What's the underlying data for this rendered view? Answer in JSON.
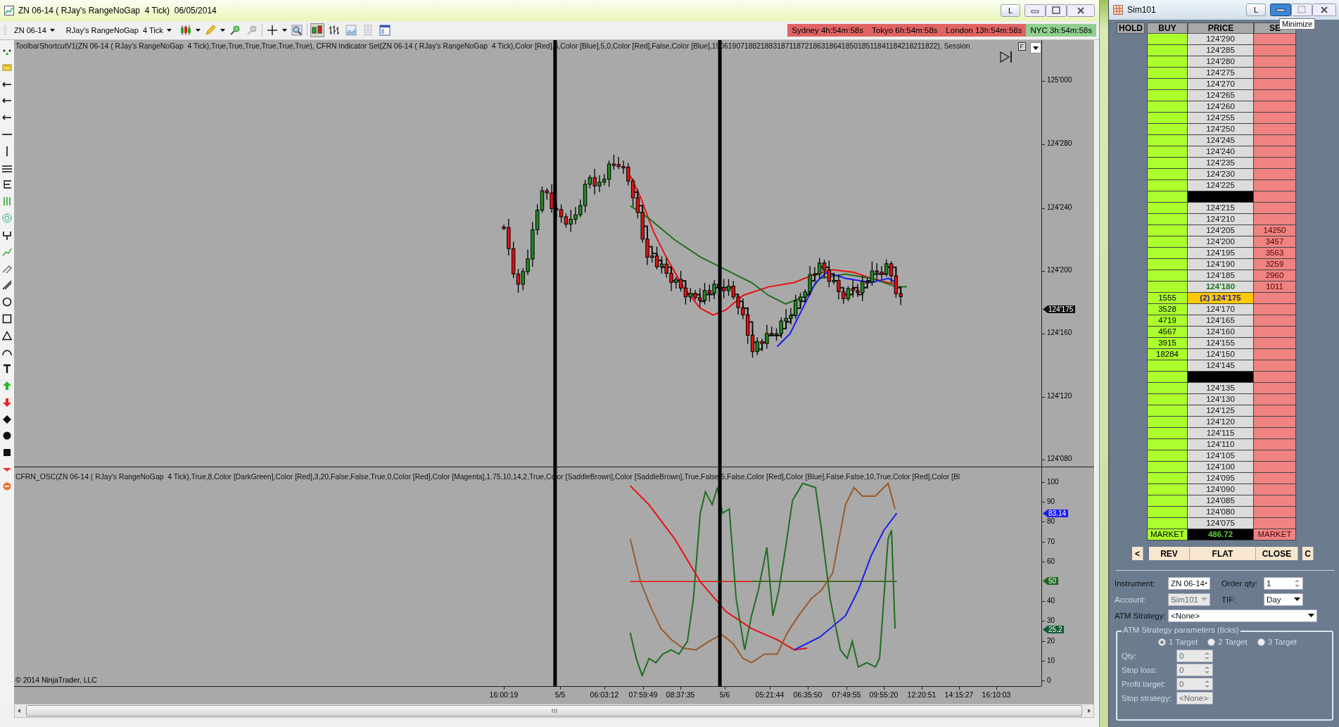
{
  "main_window": {
    "title": "ZN 06-14 ( RJay's RangeNoGap  4 Tick)  06/05/2014",
    "title_buttons": [
      "L"
    ]
  },
  "toolbar": {
    "instrument": "ZN 06-14",
    "bar_type": "RJay's RangeNoGap  4 Tick",
    "sessions": [
      {
        "label": "Sydney 4h:54m:58s",
        "color": "#e06464"
      },
      {
        "label": "Tokyo 6h:54m:58s",
        "color": "#e06464"
      },
      {
        "label": "London 13h:54m:58s",
        "color": "#e06464"
      },
      {
        "label": "NYC 3h:54m:58s",
        "color": "#90cf90"
      }
    ]
  },
  "chart": {
    "price_indicator_label": "ToolbarShortcutV1(ZN 06-14 ( RJay's RangeNoGap  4 Tick),True,True,True,True,True,True), CFRN Indicator Set(ZN 06-14 ( RJay's RangeNoGap  4 Tick),Color [Red],5,Color [Blue],5,0,Color [Red],False,Color [Blue],19061907188218831871187218631864185018511841184218211822), Session",
    "f_button": "F",
    "price_axis": [
      "125'000",
      "124'280",
      "124'240",
      "124'200",
      "124'160",
      "124'120",
      "124'080"
    ],
    "price_marker": "124'175",
    "oscillator_label": "CFRN_OSC(ZN 06-14 ( RJay's RangeNoGap  4 Tick),True,8,Color [DarkGreen],Color [Red],3,20,False,False,True,0,Color [Red],Color [Magenta],1.75,10,14,2,True,Color [SaddleBrown],Color [SaddleBrown],True,False,5,False,Color [Red],Color [Blue],False,False,10,True,Color [Red],Color [Bl",
    "osc_axis": [
      "100",
      "90",
      "80",
      "70",
      "60",
      "40",
      "30",
      "20",
      "10",
      "0"
    ],
    "osc_markers": [
      {
        "label": "83.14",
        "color": "#1c1cf0"
      },
      {
        "label": "50",
        "color": "#1e641e"
      },
      {
        "label": "25.2",
        "color": "#145a32"
      }
    ],
    "copyright": "© 2014 NinjaTrader, LLC",
    "time_axis": [
      "16:00:19",
      "5/5",
      "06:03:12",
      "07:59:49",
      "08:37:35",
      "5/6",
      "05:21:44",
      "06:35:50",
      "07:49:55",
      "09:55:20",
      "12:20:51",
      "14:15:27",
      "16:10:03"
    ]
  },
  "dom": {
    "title": "Sim101",
    "title_buttons": [
      "L"
    ],
    "tooltip": "Minimize",
    "columns": [
      "HOLD",
      "BUY",
      "PRICE",
      "SE"
    ],
    "rows": [
      {
        "kind": "price",
        "price": "124'290"
      },
      {
        "kind": "price",
        "price": "124'285"
      },
      {
        "kind": "price",
        "price": "124'280"
      },
      {
        "kind": "price",
        "price": "124'275"
      },
      {
        "kind": "price",
        "price": "124'270"
      },
      {
        "kind": "price",
        "price": "124'265"
      },
      {
        "kind": "price",
        "price": "124'260"
      },
      {
        "kind": "price",
        "price": "124'255"
      },
      {
        "kind": "price",
        "price": "124'250"
      },
      {
        "kind": "price",
        "price": "124'245"
      },
      {
        "kind": "price",
        "price": "124'240"
      },
      {
        "kind": "price",
        "price": "124'235"
      },
      {
        "kind": "price",
        "price": "124'230"
      },
      {
        "kind": "price",
        "price": "124'225"
      },
      {
        "kind": "gap"
      },
      {
        "kind": "price",
        "price": "124'215"
      },
      {
        "kind": "price",
        "price": "124'210"
      },
      {
        "kind": "price",
        "price": "124'205",
        "sell": "14250"
      },
      {
        "kind": "price",
        "price": "124'200",
        "sell": "3457"
      },
      {
        "kind": "price",
        "price": "124'195",
        "sell": "3563"
      },
      {
        "kind": "price",
        "price": "124'190",
        "sell": "3259"
      },
      {
        "kind": "price",
        "price": "124'185",
        "sell": "2960"
      },
      {
        "kind": "last",
        "price": "124'180",
        "sell": "1011"
      },
      {
        "kind": "position",
        "price": "(2) 124'175",
        "buy": "1555"
      },
      {
        "kind": "price",
        "price": "124'170",
        "buy": "3528"
      },
      {
        "kind": "price",
        "price": "124'165",
        "buy": "4719"
      },
      {
        "kind": "price",
        "price": "124'160",
        "buy": "4567"
      },
      {
        "kind": "price",
        "price": "124'155",
        "buy": "3915"
      },
      {
        "kind": "price",
        "price": "124'150",
        "buy": "18284"
      },
      {
        "kind": "price",
        "price": "124'145"
      },
      {
        "kind": "gap"
      },
      {
        "kind": "price",
        "price": "124'135"
      },
      {
        "kind": "price",
        "price": "124'130"
      },
      {
        "kind": "price",
        "price": "124'125"
      },
      {
        "kind": "price",
        "price": "124'120"
      },
      {
        "kind": "price",
        "price": "124'115"
      },
      {
        "kind": "price",
        "price": "124'110"
      },
      {
        "kind": "price",
        "price": "124'105"
      },
      {
        "kind": "price",
        "price": "124'100"
      },
      {
        "kind": "price",
        "price": "124'095"
      },
      {
        "kind": "price",
        "price": "124'090"
      },
      {
        "kind": "price",
        "price": "124'085"
      },
      {
        "kind": "price",
        "price": "124'080"
      },
      {
        "kind": "price",
        "price": "124'075"
      }
    ],
    "market": {
      "buy": "MARKET",
      "price": "486.72",
      "sell": "MARKET"
    },
    "actions": [
      "<",
      "REV",
      "FLAT",
      "CLOSE",
      "C"
    ],
    "form": {
      "instrument": {
        "label": "Instrument:",
        "value": "ZN 06-14"
      },
      "order_qty": {
        "label": "Order qty:",
        "value": "1"
      },
      "account": {
        "label": "Account:",
        "value": "Sim101",
        "disabled": true
      },
      "tif": {
        "label": "TIF:",
        "value": "Day"
      },
      "atm_strategy": {
        "label": "ATM Strategy:",
        "value": "<None>"
      },
      "atm_parameters": {
        "title": "ATM Strategy parameters (ticks)",
        "disabled": true,
        "targets": [
          {
            "label": "1 Target",
            "selected": true
          },
          {
            "label": "2 Target",
            "selected": false
          },
          {
            "label": "3 Target",
            "selected": false
          }
        ],
        "fields": [
          {
            "kind": "spinner",
            "label": "Qty:",
            "value": "0"
          },
          {
            "kind": "spinner",
            "label": "Stop loss:",
            "value": "0"
          },
          {
            "kind": "spinner",
            "label": "Profit target:",
            "value": "0"
          },
          {
            "kind": "dropdown",
            "label": "Stop strategy:",
            "value": "<None>"
          }
        ]
      }
    }
  }
}
